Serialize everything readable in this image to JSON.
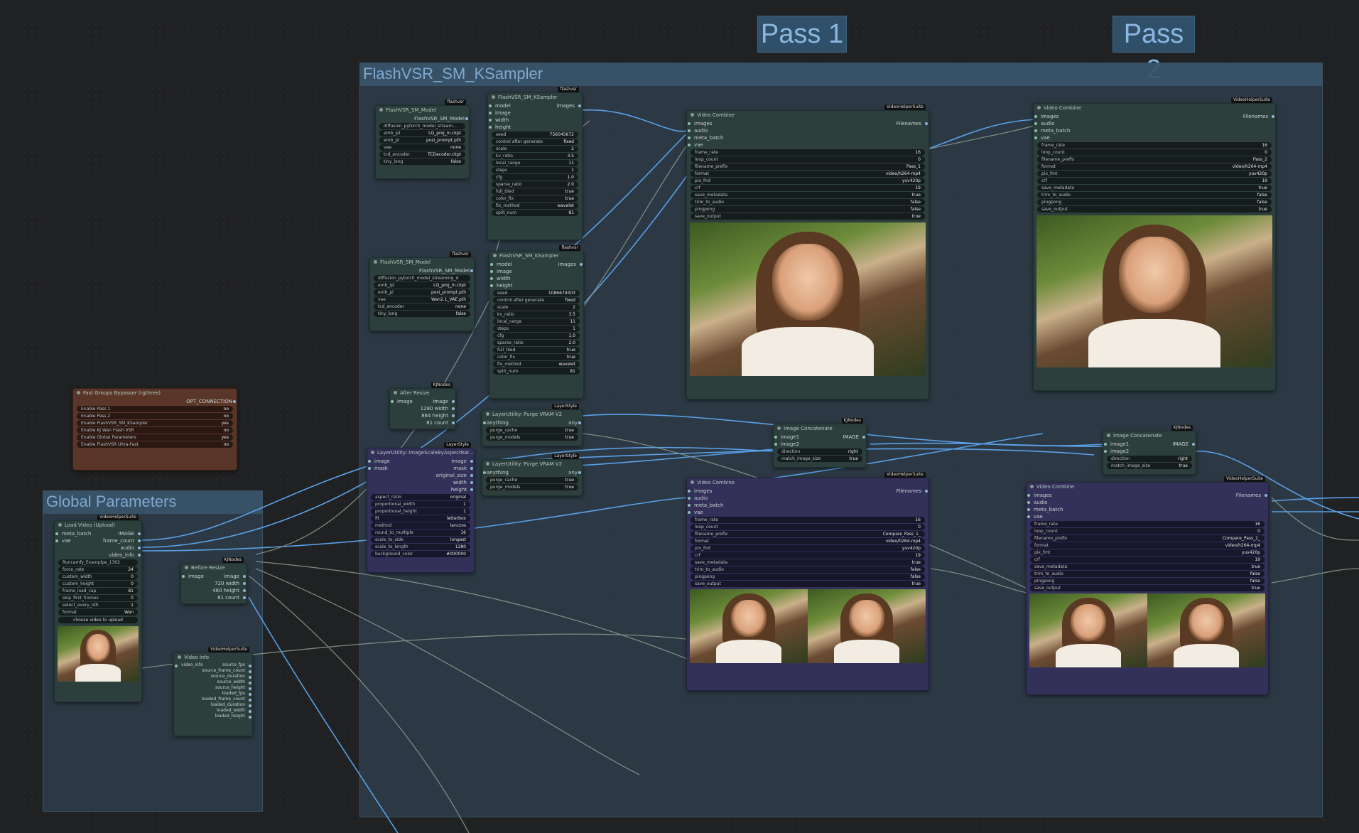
{
  "labels": {
    "pass1": "Pass 1",
    "pass2": "Pass 2"
  },
  "groups": {
    "ksampler": "FlashVSR_SM_KSampler",
    "global": "Global Parameters"
  },
  "badges": {
    "flashvsr": "flashvsr",
    "vhs": "VideoHelperSuite",
    "kj": "KJNodes",
    "layer": "LayerStyle"
  },
  "model1": {
    "title": "FlashVSR_SM_Model",
    "out": "FlashVSR_SM_Model",
    "w": [
      [
        "diffusion_pytorch_model_stream...",
        ""
      ],
      [
        "emb_ipl",
        "LQ_proj_in.ckpt"
      ],
      [
        "emb_pl",
        "posi_prompt.pth"
      ],
      [
        "vae",
        "none"
      ],
      [
        "tcd_encoder",
        "TCDecoder.ckpt"
      ],
      [
        "tiny_long",
        "false"
      ]
    ]
  },
  "model2": {
    "title": "FlashVSR_SM_Model",
    "out": "FlashVSR_SM_Model",
    "w": [
      [
        "diffusion_pytorch_model_streaming_d",
        ""
      ],
      [
        "emb_ipl",
        "LQ_proj_in.ckpt"
      ],
      [
        "emb_pl",
        "posi_prompt.pth"
      ],
      [
        "vae",
        "Wan2.1_VAE.pth"
      ],
      [
        "tcd_encoder",
        "none"
      ],
      [
        "tiny_long",
        "false"
      ]
    ]
  },
  "ks1": {
    "title": "FlashVSR_SM_KSampler",
    "inputs": [
      "model",
      "image",
      "width",
      "height"
    ],
    "out": "images",
    "w": [
      [
        "seed",
        "756045672"
      ],
      [
        "control after generate",
        "fixed"
      ],
      [
        "scale",
        "2"
      ],
      [
        "kv_ratio",
        "3.5"
      ],
      [
        "local_range",
        "11"
      ],
      [
        "steps",
        "1"
      ],
      [
        "cfg",
        "1.0"
      ],
      [
        "sparse_ratio",
        "2.0"
      ],
      [
        "full_tiled",
        "true"
      ],
      [
        "color_fix",
        "true"
      ],
      [
        "fix_method",
        "wavelet"
      ],
      [
        "split_num",
        "81"
      ]
    ]
  },
  "ks2": {
    "title": "FlashVSR_SM_KSampler",
    "inputs": [
      "model",
      "image",
      "width",
      "height"
    ],
    "out": "images",
    "w": [
      [
        "seed",
        "1086679303"
      ],
      [
        "control after generate",
        "fixed"
      ],
      [
        "scale",
        "2"
      ],
      [
        "kv_ratio",
        "3.5"
      ],
      [
        "local_range",
        "11"
      ],
      [
        "steps",
        "1"
      ],
      [
        "cfg",
        "1.0"
      ],
      [
        "sparse_ratio",
        "2.0"
      ],
      [
        "full_tiled",
        "true"
      ],
      [
        "color_fix",
        "true"
      ],
      [
        "fix_method",
        "wavelet"
      ],
      [
        "split_num",
        "81"
      ]
    ]
  },
  "vc1": {
    "title": "Video Combine",
    "inputs": [
      "images",
      "audio",
      "meta_batch",
      "vae"
    ],
    "out": "Filenames",
    "w": [
      [
        "frame_rate",
        "16"
      ],
      [
        "loop_count",
        "0"
      ],
      [
        "filename_prefix",
        "Pass_1"
      ],
      [
        "format",
        "video/h264-mp4"
      ],
      [
        "pix_fmt",
        "yuv420p"
      ],
      [
        "crf",
        "19"
      ],
      [
        "save_metadata",
        "true"
      ],
      [
        "trim_to_audio",
        "false"
      ],
      [
        "pingpong",
        "false"
      ],
      [
        "save_output",
        "true"
      ]
    ]
  },
  "vc2": {
    "title": "Video Combine",
    "inputs": [
      "images",
      "audio",
      "meta_batch",
      "vae"
    ],
    "out": "Filenames",
    "w": [
      [
        "frame_rate",
        "16"
      ],
      [
        "loop_count",
        "0"
      ],
      [
        "filename_prefix",
        "Pass_2"
      ],
      [
        "format",
        "video/h264-mp4"
      ],
      [
        "pix_fmt",
        "yuv420p"
      ],
      [
        "crf",
        "19"
      ],
      [
        "save_metadata",
        "true"
      ],
      [
        "trim_to_audio",
        "false"
      ],
      [
        "pingpong",
        "false"
      ],
      [
        "save_output",
        "true"
      ]
    ]
  },
  "vc3": {
    "title": "Video Combine",
    "inputs": [
      "images",
      "audio",
      "meta_batch",
      "vae"
    ],
    "out": "Filenames",
    "w": [
      [
        "frame_rate",
        "16"
      ],
      [
        "loop_count",
        "0"
      ],
      [
        "filename_prefix",
        "Compare_Pass_1_"
      ],
      [
        "format",
        "video/h264-mp4"
      ],
      [
        "pix_fmt",
        "yuv420p"
      ],
      [
        "crf",
        "19"
      ],
      [
        "save_metadata",
        "true"
      ],
      [
        "trim_to_audio",
        "false"
      ],
      [
        "pingpong",
        "false"
      ],
      [
        "save_output",
        "true"
      ]
    ]
  },
  "vc4": {
    "title": "Video Combine",
    "inputs": [
      "images",
      "audio",
      "meta_batch",
      "vae"
    ],
    "out": "Filenames",
    "w": [
      [
        "frame_rate",
        "16"
      ],
      [
        "loop_count",
        "0"
      ],
      [
        "filename_prefix",
        "Compare_Pass_2_"
      ],
      [
        "format",
        "video/h264-mp4"
      ],
      [
        "pix_fmt",
        "yuv420p"
      ],
      [
        "crf",
        "19"
      ],
      [
        "save_metadata",
        "true"
      ],
      [
        "trim_to_audio",
        "false"
      ],
      [
        "pingpong",
        "false"
      ],
      [
        "save_output",
        "true"
      ]
    ]
  },
  "ic1": {
    "title": "Image Concatenate",
    "inputs": [
      "image1",
      "image2"
    ],
    "out": "IMAGE",
    "w": [
      [
        "direction",
        "right"
      ],
      [
        "match_image_size",
        "true"
      ]
    ]
  },
  "ic2": {
    "title": "Image Concatenate",
    "inputs": [
      "image1",
      "image2"
    ],
    "out": "IMAGE",
    "w": [
      [
        "direction",
        "right"
      ],
      [
        "match_image_size",
        "true"
      ]
    ]
  },
  "purge1": {
    "title": "LayerUtility: Purge VRAM V2",
    "in": "anything",
    "out": "any",
    "w": [
      [
        "purge_cache",
        "true"
      ],
      [
        "purge_models",
        "true"
      ]
    ]
  },
  "purge2": {
    "title": "LayerUtility: Purge VRAM V2",
    "in": "anything",
    "out": "any",
    "w": [
      [
        "purge_cache",
        "true"
      ],
      [
        "purge_models",
        "true"
      ]
    ]
  },
  "afterResize": {
    "title": "After Resize",
    "in": "image",
    "outs": [
      "image",
      "1280 width",
      "864 height",
      "81 count"
    ]
  },
  "beforeResize": {
    "title": "Before Resize",
    "in": "image",
    "outs": [
      "image",
      "720 width",
      "480 height",
      "81 count"
    ]
  },
  "scale": {
    "title": "LayerUtility: ImageScaleByAspectRat...",
    "inputs": [
      "image",
      "mask"
    ],
    "outs": [
      "image",
      "mask",
      "original_size",
      "width",
      "height"
    ],
    "w": [
      [
        "aspect_ratio",
        "original"
      ],
      [
        "proportional_width",
        "1"
      ],
      [
        "proportional_height",
        "1"
      ],
      [
        "fit",
        "letterbox"
      ],
      [
        "method",
        "lanczos"
      ],
      [
        "round_to_multiple",
        "16"
      ],
      [
        "scale_to_side",
        "longest"
      ],
      [
        "scale_to_length",
        "1280"
      ],
      [
        "background_color",
        "#000000"
      ]
    ]
  },
  "bypasser": {
    "title": "Fast Groups Bypasser (rgthree)",
    "out": "OPT_CONNECTION",
    "w": [
      [
        "Enable Pass 1",
        "no"
      ],
      [
        "Enable Pass 2",
        "no"
      ],
      [
        "Enable FlashVSR_SM_KSampler",
        "yes"
      ],
      [
        "Enable KJ Wan Flash VSR",
        "no"
      ],
      [
        "Enable Global Parameters",
        "yes"
      ],
      [
        "Enable FlashVSR Ultra-Fast",
        "no"
      ]
    ]
  },
  "loadVideo": {
    "title": "Load Video (Upload)",
    "inputs": [
      "meta_batch",
      "vae"
    ],
    "outs": [
      "IMAGE",
      "frame_count",
      "audio",
      "video_info"
    ],
    "w": [
      [
        "Runcamfy_Examplpe_1302",
        ""
      ],
      [
        "force_rate",
        "24"
      ],
      [
        "custom_width",
        "0"
      ],
      [
        "custom_height",
        "0"
      ],
      [
        "frame_load_cap",
        "81"
      ],
      [
        "skip_first_frames",
        "0"
      ],
      [
        "select_every_nth",
        "1"
      ],
      [
        "format",
        "Wan"
      ]
    ],
    "upload": "choose video to upload"
  },
  "videoInfo": {
    "title": "Video Info",
    "in": "video_info",
    "outs": [
      "source_fps",
      "source_frame_count",
      "source_duration",
      "source_width",
      "source_height",
      "loaded_fps",
      "loaded_frame_count",
      "loaded_duration",
      "loaded_width",
      "loaded_height"
    ]
  }
}
